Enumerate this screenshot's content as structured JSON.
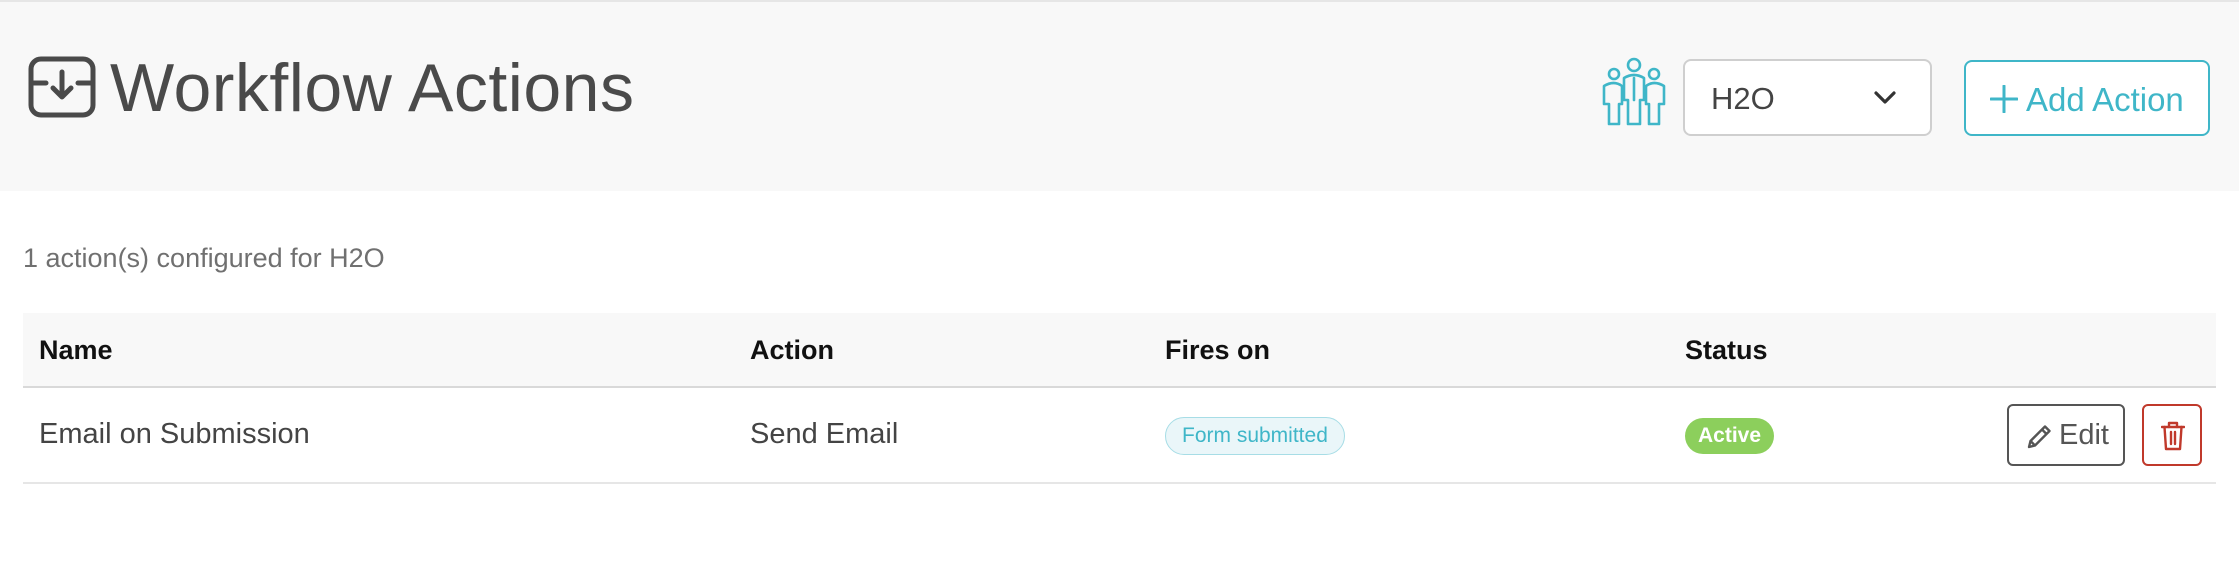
{
  "header": {
    "title": "Workflow Actions",
    "title_icon": "inbox-download-icon",
    "team_icon": "team-people-icon",
    "org_select": {
      "value": "H2O",
      "icon": "chevron-down-icon"
    },
    "add_button": {
      "label": "Add Action",
      "icon": "plus-icon"
    }
  },
  "summary": "1 action(s) configured for H2O",
  "table": {
    "columns": [
      "Name",
      "Action",
      "Fires on",
      "Status"
    ],
    "rows": [
      {
        "name": "Email on Submission",
        "action": "Send Email",
        "fires_on": "Form submitted",
        "status": "Active",
        "edit_label": "Edit",
        "edit_icon": "pencil-icon",
        "delete_icon": "trash-icon"
      }
    ]
  },
  "colors": {
    "accent": "#3fb6c8",
    "status_active": "#8ccf5c",
    "danger": "#c0392b",
    "header_bg": "#f8f8f8"
  }
}
